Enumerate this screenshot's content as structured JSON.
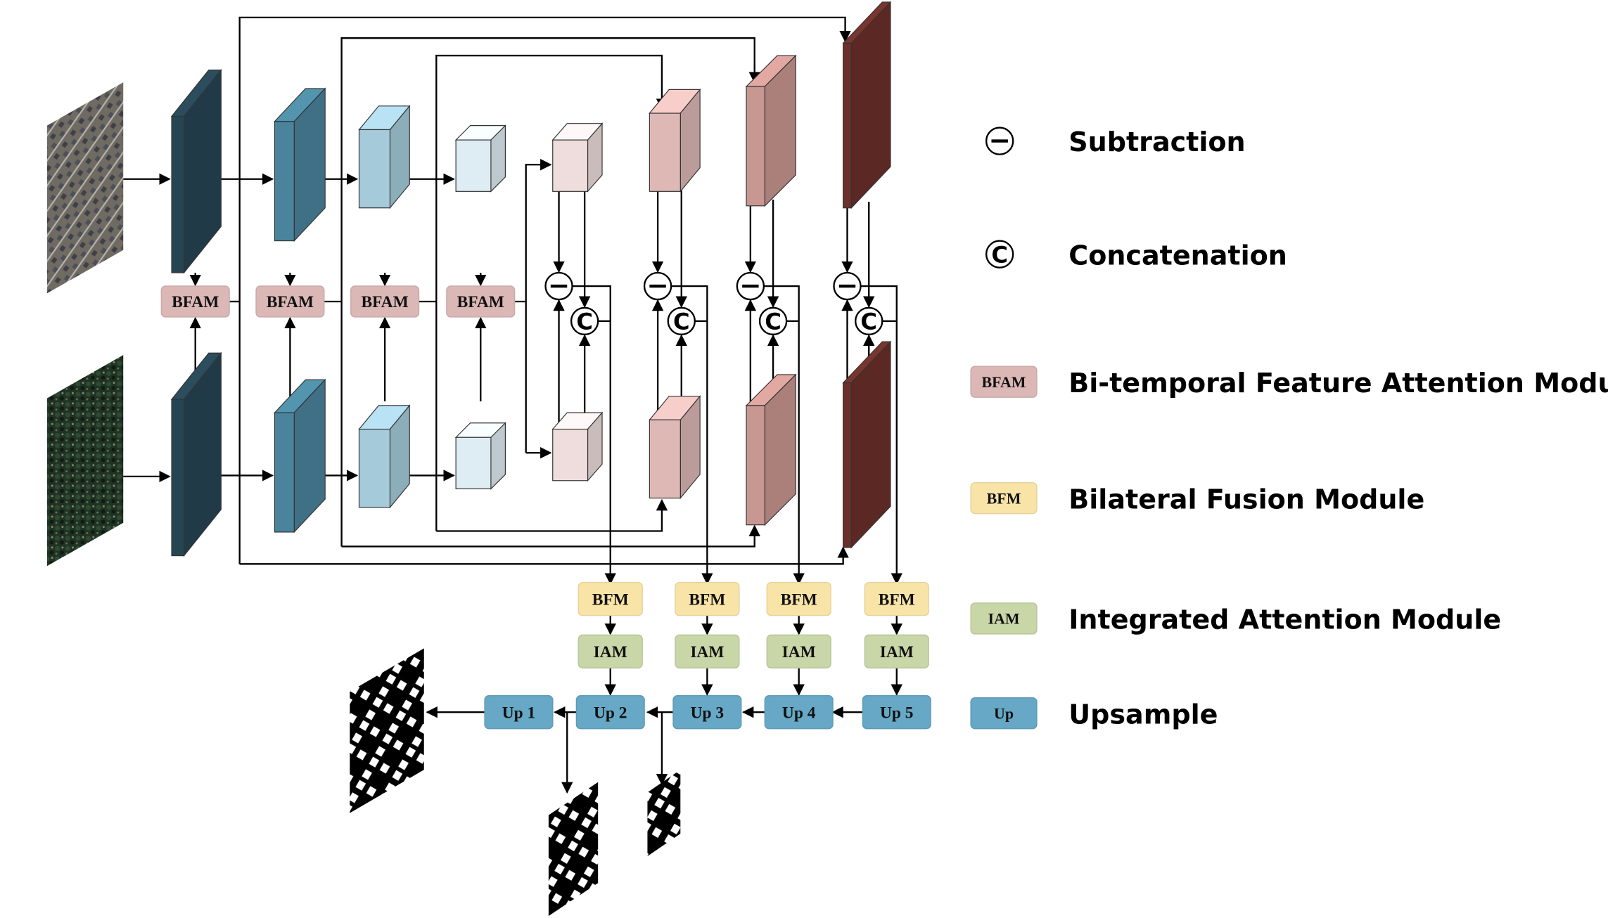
{
  "diagram": {
    "modules": {
      "bfam": [
        "BFAM",
        "BFAM",
        "BFAM",
        "BFAM"
      ],
      "bfm": [
        "BFM",
        "BFM",
        "BFM",
        "BFM"
      ],
      "iam": [
        "IAM",
        "IAM",
        "IAM",
        "IAM"
      ],
      "up": [
        "Up 1",
        "Up 2",
        "Up 3",
        "Up 4",
        "Up 5"
      ]
    },
    "operators": {
      "subtraction_symbol": "−",
      "concatenation_symbol": "C"
    },
    "inputs": [
      "pre-change image (T1)",
      "post-change image (T2)"
    ],
    "outputs": [
      "change map (full)",
      "change map (aux 1)",
      "change map (aux 2)"
    ]
  },
  "legend": [
    {
      "key": "subtraction",
      "symbol": "−",
      "label": "Subtraction"
    },
    {
      "key": "concatenation",
      "symbol": "C",
      "label": "Concatenation"
    },
    {
      "key": "bfam",
      "badge": "BFAM",
      "label": "Bi-temporal Feature Attention Module"
    },
    {
      "key": "bfm",
      "badge": "BFM",
      "label": "Bilateral Fusion Module"
    },
    {
      "key": "iam",
      "badge": "IAM",
      "label": "Integrated Attention Module"
    },
    {
      "key": "up",
      "badge": "Up",
      "label": "Upsample"
    }
  ],
  "colors": {
    "bfam": "#dbb8b6",
    "bfm": "#f9e4a8",
    "iam": "#c8d6a8",
    "up": "#66a8c5",
    "encoder": [
      "#264553",
      "#4a849c",
      "#a5cbdb",
      "#deecf3"
    ],
    "decoder": [
      "#efdddd",
      "#ddb8b5",
      "#c99791",
      "#6c2f29"
    ]
  }
}
